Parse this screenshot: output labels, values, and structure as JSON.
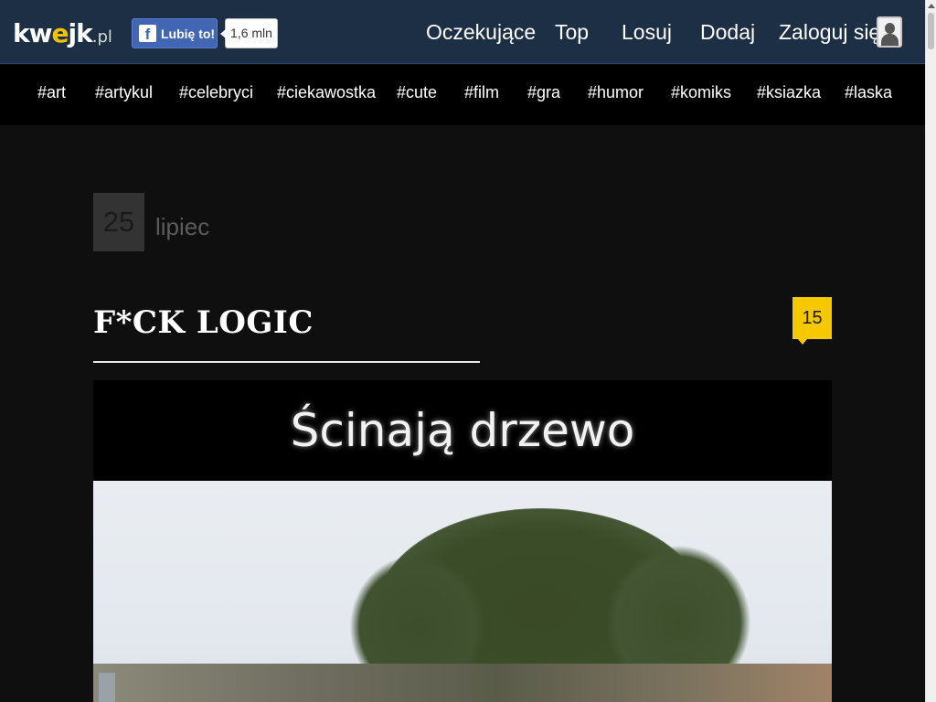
{
  "header": {
    "logo": {
      "main_k": "kw",
      "main_e": "e",
      "main_rest": "jk",
      "suffix": ".pl"
    },
    "facebook": {
      "like_label": "Lubię to!",
      "count": "1,6 mln",
      "icon": "facebook-f-icon"
    },
    "nav": [
      "Oczekujące",
      "Top",
      "Losuj",
      "Dodaj",
      "Zaloguj się"
    ],
    "user_icon": "user-avatar-icon"
  },
  "tags": [
    "#art",
    "#artykul",
    "#celebryci",
    "#ciekawostka",
    "#cute",
    "#film",
    "#gra",
    "#humor",
    "#komiks",
    "#ksiazka",
    "#laska"
  ],
  "post": {
    "date_day": "25",
    "date_month": "lipiec",
    "title": "F*CK LOGIC",
    "comments_count": "15",
    "image_caption": "Ścinają drzewo"
  },
  "colors": {
    "header_bg": "#1c2f45",
    "tag_bar_bg": "#000000",
    "accent_yellow": "#f5c800",
    "facebook_blue": "#4267b2"
  }
}
